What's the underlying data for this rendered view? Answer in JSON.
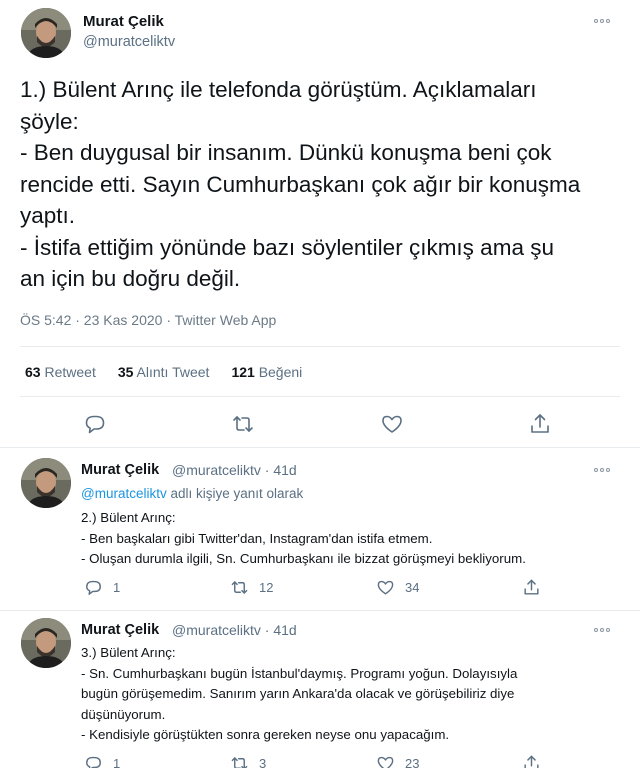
{
  "main_tweet": {
    "author_name": "Murat Çelik",
    "author_handle": "@muratceliktv",
    "lines": [
      "1.) Bülent Arınç ile telefonda görüştüm. Açıklamaları",
      "şöyle:",
      "- Ben duygusal bir insanım. Dünkü konuşma beni çok",
      "rencide etti. Sayın Cumhurbaşkanı çok ağır bir konuşma",
      "yaptı.",
      "- İstifa ettiğim yönünde bazı söylentiler çıkmış ama şu",
      "an için bu doğru değil."
    ],
    "meta": "ÖS 5:42 · 23 Kas 2020 · Twitter Web App",
    "stats": {
      "retweets_count": "63",
      "retweets_label": "Retweet",
      "quotes_count": "35",
      "quotes_label": "Alıntı Tweet",
      "likes_count": "121",
      "likes_label": "Beğeni"
    },
    "actions": [
      "reply-icon",
      "retweet-icon",
      "like-icon",
      "share-icon"
    ]
  },
  "replies": [
    {
      "author_name": "Murat Çelik",
      "author_handle_time": "@muratceliktv · 41d",
      "reply_to_mention": "@muratceliktv",
      "reply_to_suffix": " adlı kişiye yanıt olarak",
      "lines": [
        "2.) Bülent Arınç:",
        "- Ben başkaları gibi Twitter'dan, Instagram'dan istifa etmem.",
        "- Oluşan durumla ilgili, Sn. Cumhurbaşkanı ile bizzat görüşmeyi bekliyorum."
      ],
      "reply_count": "1",
      "retweet_count": "12",
      "like_count": "34"
    },
    {
      "author_name": "Murat Çelik",
      "author_handle_time": "@muratceliktv · 41d",
      "lines": [
        "3.) Bülent Arınç:",
        "- Sn. Cumhurbaşkanı bugün İstanbul'daymış. Programı yoğun. Dolayısıyla",
        "bugün görüşemedim. Sanırım yarın Ankara'da olacak ve görüşebiliriz diye",
        "düşünüyorum.",
        "- Kendisiyle görüştükten sonra gereken neyse onu yapacağım."
      ],
      "reply_count": "1",
      "retweet_count": "3",
      "like_count": "23"
    }
  ]
}
